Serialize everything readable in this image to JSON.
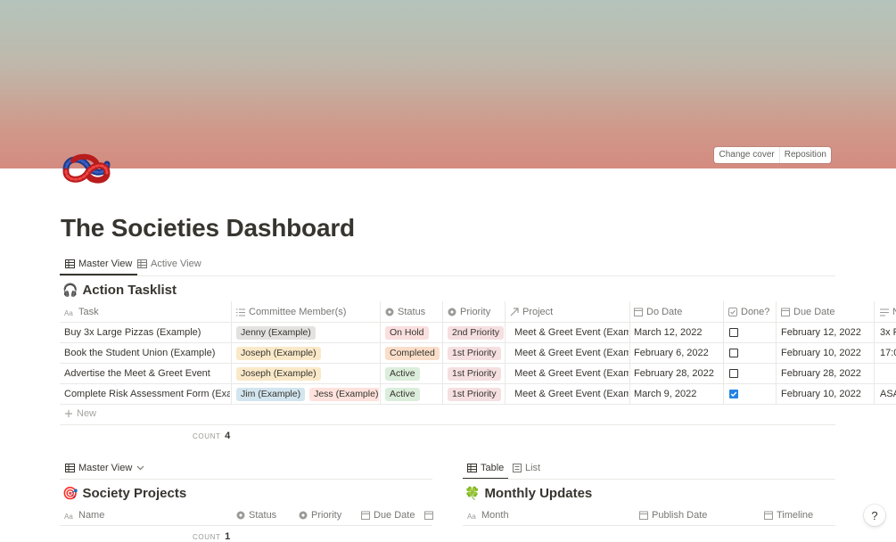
{
  "cover": {
    "change_label": "Change cover",
    "reposition_label": "Reposition"
  },
  "page": {
    "title": "The Societies Dashboard",
    "icon": "reef-knot-icon"
  },
  "view_tabs": [
    {
      "label": "Master View",
      "icon": "table-icon",
      "active": true
    },
    {
      "label": "Active View",
      "icon": "table-icon",
      "active": false
    }
  ],
  "tasklist": {
    "title": "Action Tasklist",
    "emoji": "🎧",
    "columns": [
      {
        "label": "Task",
        "icon": "text-aa-icon"
      },
      {
        "label": "Committee Member(s)",
        "icon": "list-icon"
      },
      {
        "label": "Status",
        "icon": "status-icon"
      },
      {
        "label": "Priority",
        "icon": "status-icon"
      },
      {
        "label": "Project",
        "icon": "relation-arrow-icon"
      },
      {
        "label": "Do Date",
        "icon": "calendar-icon"
      },
      {
        "label": "Done?",
        "icon": "checkbox-icon"
      },
      {
        "label": "Due Date",
        "icon": "calendar-icon"
      },
      {
        "label": "N",
        "icon": "text-lines-icon"
      }
    ],
    "rows": [
      {
        "task": "Buy 3x Large Pizzas (Example)",
        "members": [
          {
            "name": "Jenny (Example)",
            "color": "#e3e2e0"
          }
        ],
        "status": {
          "label": "On Hold",
          "color": "#fadfdf"
        },
        "priority": {
          "label": "2nd Priority",
          "color": "#f5dfe0"
        },
        "project": "Meet & Greet Event (Example)",
        "do_date": "March 12, 2022",
        "done": false,
        "due_date": "February 12, 2022",
        "notes": "3x P"
      },
      {
        "task": "Book the Student Union (Example)",
        "members": [
          {
            "name": "Joseph (Example)",
            "color": "#fae9c9"
          }
        ],
        "status": {
          "label": "Completed",
          "color": "#fadec9"
        },
        "priority": {
          "label": "1st Priority",
          "color": "#f5dfe0"
        },
        "project": "Meet & Greet Event (Example)",
        "do_date": "February 6, 2022",
        "done": false,
        "due_date": "February 10, 2022",
        "notes": "17:0"
      },
      {
        "task": "Advertise the Meet & Greet Event",
        "members": [
          {
            "name": "Joseph (Example)",
            "color": "#fae9c9"
          }
        ],
        "status": {
          "label": "Active",
          "color": "#dbeddb"
        },
        "priority": {
          "label": "1st Priority",
          "color": "#f5dfe0"
        },
        "project": "Meet & Greet Event (Example)",
        "do_date": "February 28, 2022",
        "done": false,
        "due_date": "February 28, 2022",
        "notes": ""
      },
      {
        "task": "Complete Risk Assessment Form (Example)",
        "members": [
          {
            "name": "Jim (Example)",
            "color": "#d3e5ef"
          },
          {
            "name": "Jess (Example)",
            "color": "#ffe2dd"
          }
        ],
        "status": {
          "label": "Active",
          "color": "#dbeddb"
        },
        "priority": {
          "label": "1st Priority",
          "color": "#f5dfe0"
        },
        "project": "Meet & Greet Event (Example)",
        "do_date": "March 9, 2022",
        "done": true,
        "due_date": "February 10, 2022",
        "notes": "ASA"
      }
    ],
    "new_label": "New",
    "count_label": "COUNT",
    "count_value": "4"
  },
  "projects": {
    "view_label": "Master View",
    "title": "Society Projects",
    "emoji": "🎯",
    "columns": [
      "Name",
      "Status",
      "Priority",
      "Due Date"
    ],
    "count_label": "COUNT",
    "count_value": "1"
  },
  "updates": {
    "tabs": [
      {
        "label": "Table",
        "active": true
      },
      {
        "label": "List",
        "active": false
      }
    ],
    "title": "Monthly Updates",
    "emoji": "🍀",
    "columns": [
      "Month",
      "Publish Date",
      "Timeline"
    ]
  },
  "help": {
    "label": "?"
  }
}
